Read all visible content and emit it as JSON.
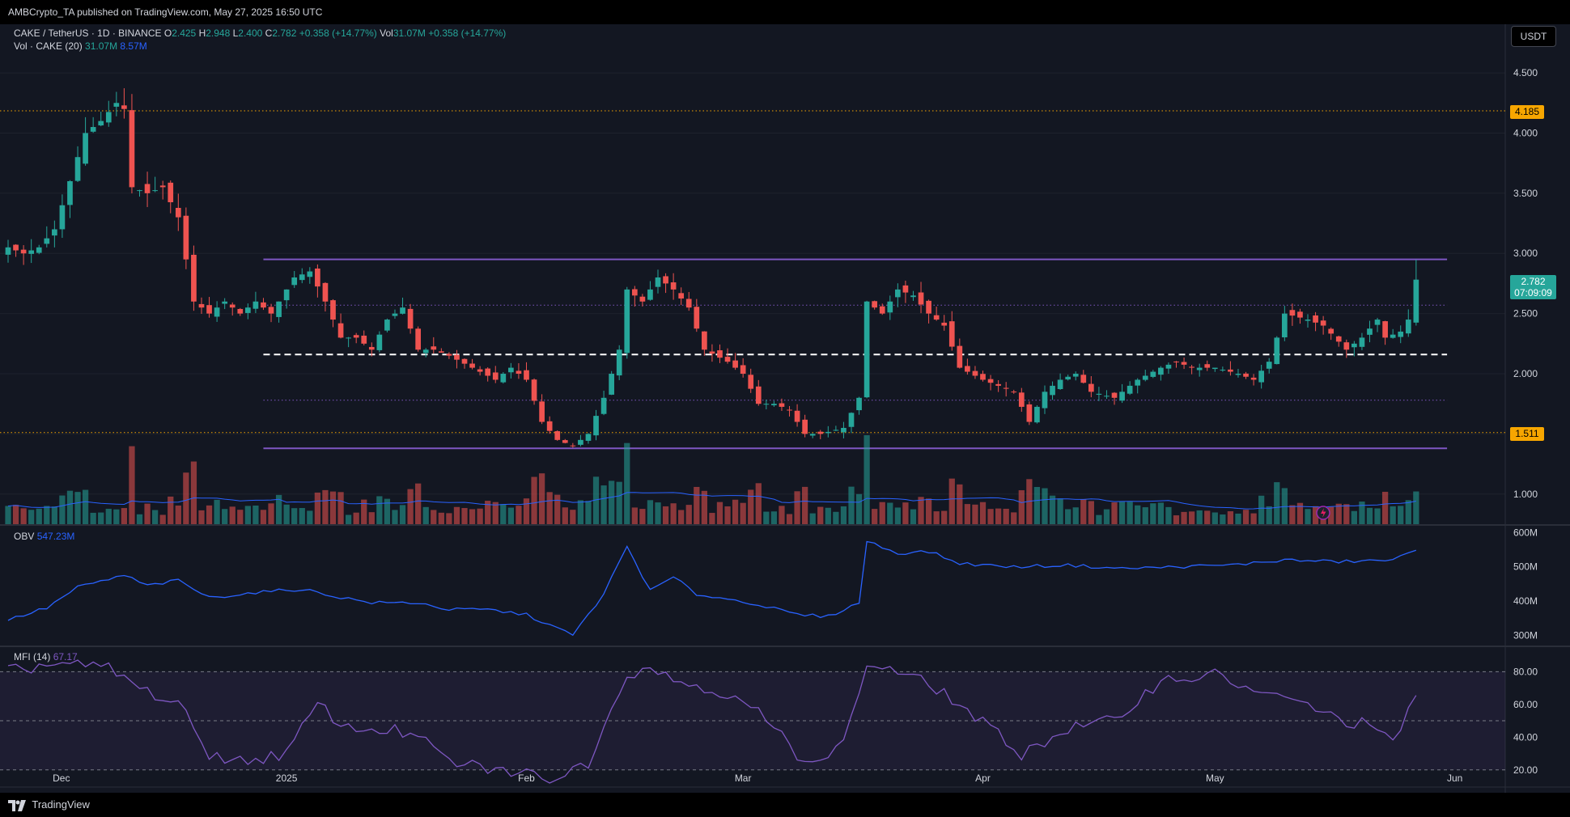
{
  "header": {
    "published_text": "AMBCrypto_TA published on TradingView.com, May 27, 2025 16:50 UTC"
  },
  "footer": {
    "brand": "TradingView"
  },
  "legend": {
    "symbol": "CAKE / TetherUS · 1D · BINANCE",
    "o_label": "O",
    "o_value": "2.425",
    "h_label": "H",
    "h_value": "2.948",
    "l_label": "L",
    "l_value": "2.400",
    "c_label": "C",
    "c_value": "2.782",
    "change": "+0.358 (+14.77%)",
    "vol_label": "Vol",
    "vol_value": "31.07M",
    "vol_change": "+0.358 (+14.77%)",
    "vol_ind_label": "Vol · CAKE (20)",
    "vol_ind_value": "31.07M",
    "vol_ind_ma": "8.57M"
  },
  "obv_legend": {
    "label": "OBV",
    "value": "547.23M"
  },
  "mfi_legend": {
    "label": "MFI (14)",
    "value": "67.17"
  },
  "price_scale": {
    "unit": "USDT",
    "ticks": [
      "4.500",
      "4.000",
      "3.500",
      "3.000",
      "2.500",
      "2.000",
      "1.500",
      "1.000"
    ],
    "last_price": "2.782",
    "countdown": "07:09:09",
    "levels": [
      {
        "label": "4.185",
        "color": "#f7a600"
      },
      {
        "label": "1.511",
        "color": "#f7a600"
      }
    ]
  },
  "obv_scale": {
    "ticks": [
      "600M",
      "500M",
      "400M",
      "300M"
    ]
  },
  "mfi_scale": {
    "ticks": [
      "80.00",
      "60.00",
      "40.00",
      "20.00"
    ]
  },
  "time_axis": {
    "labels": [
      "Dec",
      "2025",
      "Feb",
      "Mar",
      "Apr",
      "May",
      "Jun"
    ]
  },
  "colors": {
    "up": "#26a69a",
    "down": "#ef5350",
    "range": "#7e57c2",
    "orange": "#f7a600",
    "obv": "#2962ff",
    "mfi": "#7e57c2"
  },
  "chart_data": {
    "type": "candlestick",
    "title": "CAKE / TetherUS · 1D · BINANCE",
    "ylim": [
      0.75,
      4.85
    ],
    "y_ticks": [
      1.0,
      1.5,
      2.0,
      2.5,
      3.0,
      3.5,
      4.0,
      4.5
    ],
    "x_start": "2024-11-26",
    "x_end": "2025-06-07",
    "support_resistance": [
      {
        "name": "range-high",
        "value": 2.95,
        "style": "solid",
        "color": "#7e57c2",
        "x_from": "2024-12-29",
        "x_to": "2025-05-31"
      },
      {
        "name": "range-upper-quarter",
        "value": 2.57,
        "style": "dotted",
        "color": "#7e57c2",
        "x_from": "2024-12-29",
        "x_to": "2025-05-31"
      },
      {
        "name": "range-mid",
        "value": 2.16,
        "style": "dashed",
        "color": "#ffffff",
        "x_from": "2024-12-29",
        "x_to": "2025-05-31"
      },
      {
        "name": "range-lower-quarter",
        "value": 1.78,
        "style": "dotted",
        "color": "#7e57c2",
        "x_from": "2024-12-29",
        "x_to": "2025-05-31"
      },
      {
        "name": "range-low",
        "value": 1.38,
        "style": "solid",
        "color": "#7e57c2",
        "x_from": "2024-12-29",
        "x_to": "2025-05-31"
      },
      {
        "name": "level-4185",
        "value": 4.185,
        "style": "dotted",
        "color": "#f7a600"
      },
      {
        "name": "level-1511",
        "value": 1.511,
        "style": "dotted",
        "color": "#f7a600"
      }
    ],
    "close_anchors": [
      [
        "2024-11-26",
        3.05
      ],
      [
        "2024-11-28",
        3.0
      ],
      [
        "2024-11-30",
        3.05
      ],
      [
        "2024-12-02",
        3.2
      ],
      [
        "2024-12-04",
        3.6
      ],
      [
        "2024-12-06",
        4.0
      ],
      [
        "2024-12-08",
        4.1
      ],
      [
        "2024-12-10",
        4.25
      ],
      [
        "2024-12-11",
        4.2
      ],
      [
        "2024-12-12",
        3.55
      ],
      [
        "2024-12-14",
        3.5
      ],
      [
        "2024-12-16",
        3.55
      ],
      [
        "2024-12-18",
        3.3
      ],
      [
        "2024-12-20",
        2.6
      ],
      [
        "2024-12-22",
        2.5
      ],
      [
        "2024-12-24",
        2.6
      ],
      [
        "2024-12-26",
        2.5
      ],
      [
        "2024-12-28",
        2.6
      ],
      [
        "2024-12-30",
        2.5
      ],
      [
        "2025-01-02",
        2.8
      ],
      [
        "2025-01-04",
        2.85
      ],
      [
        "2025-01-06",
        2.6
      ],
      [
        "2025-01-08",
        2.3
      ],
      [
        "2025-01-10",
        2.3
      ],
      [
        "2025-01-12",
        2.2
      ],
      [
        "2025-01-14",
        2.45
      ],
      [
        "2025-01-16",
        2.55
      ],
      [
        "2025-01-18",
        2.2
      ],
      [
        "2025-01-20",
        2.2
      ],
      [
        "2025-01-22",
        2.15
      ],
      [
        "2025-01-25",
        2.05
      ],
      [
        "2025-01-28",
        1.95
      ],
      [
        "2025-01-30",
        2.05
      ],
      [
        "2025-02-01",
        1.95
      ],
      [
        "2025-02-03",
        1.6
      ],
      [
        "2025-02-05",
        1.45
      ],
      [
        "2025-02-07",
        1.4
      ],
      [
        "2025-02-09",
        1.5
      ],
      [
        "2025-02-11",
        1.8
      ],
      [
        "2025-02-13",
        2.2
      ],
      [
        "2025-02-14",
        2.7
      ],
      [
        "2025-02-16",
        2.6
      ],
      [
        "2025-02-18",
        2.8
      ],
      [
        "2025-02-20",
        2.7
      ],
      [
        "2025-02-22",
        2.55
      ],
      [
        "2025-02-24",
        2.2
      ],
      [
        "2025-02-27",
        2.1
      ],
      [
        "2025-03-01",
        2.0
      ],
      [
        "2025-03-03",
        1.75
      ],
      [
        "2025-03-05",
        1.75
      ],
      [
        "2025-03-07",
        1.7
      ],
      [
        "2025-03-09",
        1.5
      ],
      [
        "2025-03-11",
        1.5
      ],
      [
        "2025-03-14",
        1.55
      ],
      [
        "2025-03-16",
        1.8
      ],
      [
        "2025-03-17",
        2.6
      ],
      [
        "2025-03-19",
        2.5
      ],
      [
        "2025-03-21",
        2.7
      ],
      [
        "2025-03-23",
        2.65
      ],
      [
        "2025-03-25",
        2.5
      ],
      [
        "2025-03-27",
        2.4
      ],
      [
        "2025-03-29",
        2.05
      ],
      [
        "2025-04-01",
        1.95
      ],
      [
        "2025-04-03",
        1.9
      ],
      [
        "2025-04-05",
        1.85
      ],
      [
        "2025-04-07",
        1.6
      ],
      [
        "2025-04-09",
        1.85
      ],
      [
        "2025-04-11",
        1.95
      ],
      [
        "2025-04-13",
        2.0
      ],
      [
        "2025-04-15",
        1.85
      ],
      [
        "2025-04-18",
        1.8
      ],
      [
        "2025-04-21",
        1.95
      ],
      [
        "2025-04-24",
        2.05
      ],
      [
        "2025-04-26",
        2.1
      ],
      [
        "2025-04-28",
        2.05
      ],
      [
        "2025-05-01",
        2.05
      ],
      [
        "2025-05-04",
        2.0
      ],
      [
        "2025-05-06",
        1.95
      ],
      [
        "2025-05-08",
        2.1
      ],
      [
        "2025-05-10",
        2.5
      ],
      [
        "2025-05-13",
        2.45
      ],
      [
        "2025-05-15",
        2.4
      ],
      [
        "2025-05-18",
        2.2
      ],
      [
        "2025-05-20",
        2.3
      ],
      [
        "2025-05-22",
        2.45
      ],
      [
        "2025-05-23",
        2.3
      ],
      [
        "2025-05-25",
        2.35
      ],
      [
        "2025-05-26",
        2.45
      ],
      [
        "2025-05-27",
        2.782
      ]
    ],
    "last": {
      "open": 2.425,
      "high": 2.948,
      "low": 2.4,
      "close": 2.782
    },
    "volume": {
      "last": "31.07M",
      "ma20": "8.57M"
    },
    "obv": {
      "ylim": [
        270,
        620
      ],
      "anchors": [
        [
          "2024-11-26",
          345
        ],
        [
          "2024-12-01",
          380
        ],
        [
          "2024-12-05",
          440
        ],
        [
          "2024-12-11",
          475
        ],
        [
          "2024-12-14",
          445
        ],
        [
          "2024-12-18",
          460
        ],
        [
          "2024-12-22",
          410
        ],
        [
          "2024-12-28",
          425
        ],
        [
          "2025-01-03",
          435
        ],
        [
          "2025-01-07",
          415
        ],
        [
          "2025-01-12",
          395
        ],
        [
          "2025-01-18",
          395
        ],
        [
          "2025-01-22",
          375
        ],
        [
          "2025-01-27",
          375
        ],
        [
          "2025-02-01",
          360
        ],
        [
          "2025-02-07",
          300
        ],
        [
          "2025-02-11",
          420
        ],
        [
          "2025-02-14",
          560
        ],
        [
          "2025-02-17",
          430
        ],
        [
          "2025-02-20",
          470
        ],
        [
          "2025-02-23",
          420
        ],
        [
          "2025-03-02",
          395
        ],
        [
          "2025-03-08",
          360
        ],
        [
          "2025-03-12",
          355
        ],
        [
          "2025-03-16",
          395
        ],
        [
          "2025-03-17",
          575
        ],
        [
          "2025-03-21",
          540
        ],
        [
          "2025-03-25",
          545
        ],
        [
          "2025-03-29",
          510
        ],
        [
          "2025-04-05",
          500
        ],
        [
          "2025-04-12",
          505
        ],
        [
          "2025-04-19",
          495
        ],
        [
          "2025-04-26",
          500
        ],
        [
          "2025-05-03",
          505
        ],
        [
          "2025-05-10",
          520
        ],
        [
          "2025-05-17",
          515
        ],
        [
          "2025-05-24",
          520
        ],
        [
          "2025-05-27",
          547
        ]
      ]
    },
    "mfi": {
      "ylim": [
        10,
        95
      ],
      "bands": [
        20,
        50,
        80
      ],
      "anchors": [
        [
          "2024-11-26",
          80
        ],
        [
          "2024-12-02",
          85
        ],
        [
          "2024-12-09",
          82
        ],
        [
          "2024-12-13",
          70
        ],
        [
          "2024-12-18",
          60
        ],
        [
          "2024-12-22",
          30
        ],
        [
          "2024-12-26",
          25
        ],
        [
          "2025-01-01",
          30
        ],
        [
          "2025-01-05",
          60
        ],
        [
          "2025-01-09",
          45
        ],
        [
          "2025-01-14",
          45
        ],
        [
          "2025-01-18",
          40
        ],
        [
          "2025-01-22",
          25
        ],
        [
          "2025-01-28",
          20
        ],
        [
          "2025-02-05",
          15
        ],
        [
          "2025-02-09",
          25
        ],
        [
          "2025-02-13",
          70
        ],
        [
          "2025-02-16",
          85
        ],
        [
          "2025-02-20",
          75
        ],
        [
          "2025-02-25",
          70
        ],
        [
          "2025-03-03",
          55
        ],
        [
          "2025-03-08",
          30
        ],
        [
          "2025-03-12",
          25
        ],
        [
          "2025-03-15",
          50
        ],
        [
          "2025-03-17",
          85
        ],
        [
          "2025-03-21",
          80
        ],
        [
          "2025-03-26",
          70
        ],
        [
          "2025-04-02",
          45
        ],
        [
          "2025-04-06",
          30
        ],
        [
          "2025-04-12",
          45
        ],
        [
          "2025-04-18",
          50
        ],
        [
          "2025-04-24",
          75
        ],
        [
          "2025-05-01",
          78
        ],
        [
          "2025-05-08",
          65
        ],
        [
          "2025-05-13",
          60
        ],
        [
          "2025-05-17",
          50
        ],
        [
          "2025-05-21",
          48
        ],
        [
          "2025-05-24",
          35
        ],
        [
          "2025-05-27",
          67.17
        ]
      ]
    }
  }
}
